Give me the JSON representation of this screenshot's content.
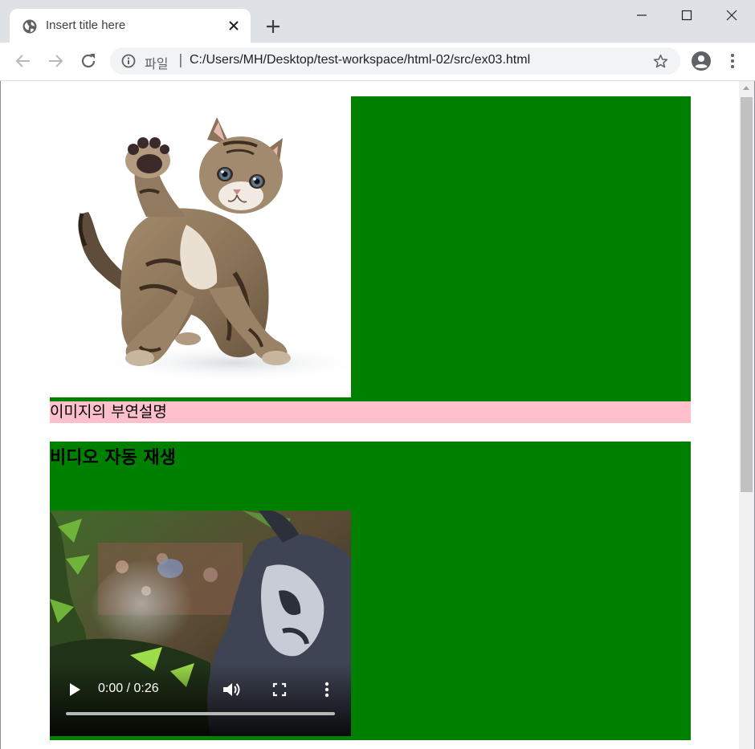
{
  "browser": {
    "tab_title": "Insert title here",
    "url_scheme_label": "파일",
    "url": "C:/Users/MH/Desktop/test-workspace/html-02/src/ex03.html"
  },
  "page": {
    "image_alt": "kitten raising paw",
    "caption": "이미지의 부연설명",
    "video_heading": "비디오 자동 재생",
    "video_time": "0:00 / 0:26",
    "video_progress": 0
  },
  "colors": {
    "figure_bg": "#008000",
    "caption_bg": "#ffc0cb",
    "tabstrip_bg": "#dee1e6"
  },
  "icons": {
    "tab": [
      "globe-icon",
      "close-icon"
    ],
    "tabstrip": [
      "new-tab-icon"
    ],
    "window": [
      "minimize-icon",
      "maximize-icon",
      "window-close-icon"
    ],
    "toolbar": [
      "back-icon",
      "forward-icon",
      "reload-icon",
      "info-icon",
      "star-icon",
      "profile-icon",
      "menu-icon"
    ],
    "video": [
      "play-icon",
      "volume-icon",
      "fullscreen-icon",
      "more-icon"
    ]
  }
}
